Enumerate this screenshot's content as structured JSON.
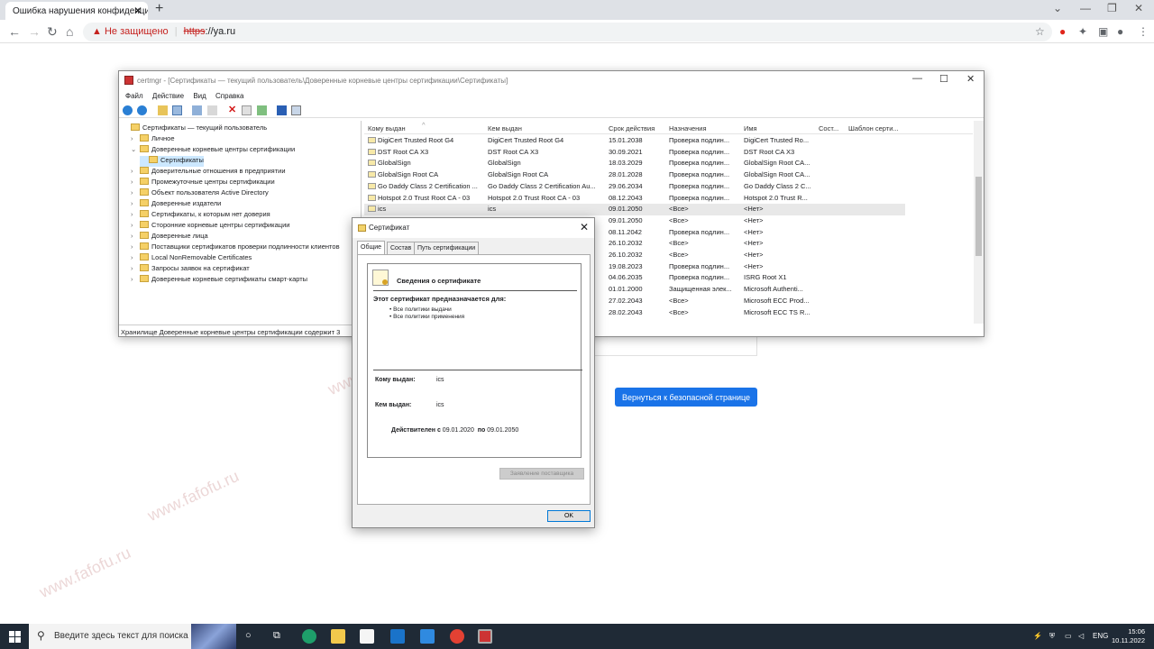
{
  "browser": {
    "tab_title": "Ошибка нарушения конфиденциальн",
    "tab_close": "✕",
    "new_tab": "+",
    "window_controls": [
      "⌄",
      "—",
      "❐",
      "✕"
    ],
    "nav": {
      "back": "←",
      "forward": "→",
      "reload": "↻",
      "home": "⌂"
    },
    "security_label": "Не защищено",
    "url_scheme": "https",
    "url_rest": "://ya.ru"
  },
  "page": {
    "back_button": "Вернуться к безопасной странице"
  },
  "certmgr": {
    "title": "certmgr - [Сертификаты — текущий пользователь\\Доверенные корневые центры сертификации\\Сертификаты]",
    "menu": [
      "Файл",
      "Действие",
      "Вид",
      "Справка"
    ],
    "tree": [
      {
        "label": "Сертификаты — текущий пользователь",
        "level": 0,
        "exp": ""
      },
      {
        "label": "Личное",
        "level": 1,
        "exp": "›"
      },
      {
        "label": "Доверенные корневые центры сертификации",
        "level": 1,
        "exp": "⌄"
      },
      {
        "label": "Сертификаты",
        "level": 2,
        "exp": ""
      },
      {
        "label": "Доверительные отношения в предприятии",
        "level": 1,
        "exp": "›"
      },
      {
        "label": "Промежуточные центры сертификации",
        "level": 1,
        "exp": "›"
      },
      {
        "label": "Объект пользователя Active Directory",
        "level": 1,
        "exp": "›"
      },
      {
        "label": "Доверенные издатели",
        "level": 1,
        "exp": "›"
      },
      {
        "label": "Сертификаты, к которым нет доверия",
        "level": 1,
        "exp": "›"
      },
      {
        "label": "Сторонние корневые центры сертификации",
        "level": 1,
        "exp": "›"
      },
      {
        "label": "Доверенные лица",
        "level": 1,
        "exp": "›"
      },
      {
        "label": "Поставщики сертификатов проверки подлинности клиентов",
        "level": 1,
        "exp": "›"
      },
      {
        "label": "Local NonRemovable Certificates",
        "level": 1,
        "exp": "›"
      },
      {
        "label": "Запросы заявок на сертификат",
        "level": 1,
        "exp": "›"
      },
      {
        "label": "Доверенные корневые сертификаты смарт-карты",
        "level": 1,
        "exp": "›"
      }
    ],
    "columns": [
      "Кому выдан",
      "Кем выдан",
      "Срок действия",
      "Назначения",
      "Имя",
      "Сост...",
      "Шаблон серти..."
    ],
    "rows": [
      [
        "DigiCert Trusted Root G4",
        "DigiCert Trusted Root G4",
        "15.01.2038",
        "Проверка подлин...",
        "DigiCert Trusted Ro..."
      ],
      [
        "DST Root CA X3",
        "DST Root CA X3",
        "30.09.2021",
        "Проверка подлин...",
        "DST Root CA X3"
      ],
      [
        "GlobalSign",
        "GlobalSign",
        "18.03.2029",
        "Проверка подлин...",
        "GlobalSign Root CA..."
      ],
      [
        "GlobalSign Root CA",
        "GlobalSign Root CA",
        "28.01.2028",
        "Проверка подлин...",
        "GlobalSign Root CA..."
      ],
      [
        "Go Daddy Class 2 Certification ...",
        "Go Daddy Class 2 Certification Au...",
        "29.06.2034",
        "Проверка подлин...",
        "Go Daddy Class 2 C..."
      ],
      [
        "Hotspot 2.0 Trust Root CA - 03",
        "Hotspot 2.0 Trust Root CA - 03",
        "08.12.2043",
        "Проверка подлин...",
        "Hotspot 2.0 Trust R..."
      ],
      [
        "ics",
        "ics",
        "09.01.2050",
        "<Все>",
        "<Нет>"
      ],
      [
        "",
        "",
        "09.01.2050",
        "<Все>",
        "<Нет>"
      ],
      [
        "",
        "",
        "08.11.2042",
        "Проверка подлин...",
        "<Нет>"
      ],
      [
        "",
        "",
        "26.10.2032",
        "<Все>",
        "<Нет>"
      ],
      [
        "",
        "",
        "26.10.2032",
        "<Все>",
        "<Нет>"
      ],
      [
        "",
        "",
        "19.08.2023",
        "Проверка подлин...",
        "<Нет>"
      ],
      [
        "",
        "",
        "04.06.2035",
        "Проверка подлин...",
        "ISRG Root X1"
      ],
      [
        "",
        "",
        "01.01.2000",
        "Защищенная элек...",
        "Microsoft Authenti..."
      ],
      [
        "",
        "",
        "27.02.2043",
        "<Все>",
        "Microsoft ECC Prod..."
      ],
      [
        "",
        "",
        "28.02.2043",
        "<Все>",
        "Microsoft ECC TS R..."
      ]
    ],
    "status": "Хранилище Доверенные корневые центры сертификации содержит 3"
  },
  "dialog": {
    "title": "Сертификат",
    "close": "✕",
    "tabs": [
      "Общие",
      "Состав",
      "Путь сертификации"
    ],
    "info_heading": "Сведения о сертификате",
    "purpose_heading": "Этот сертификат предназначается для:",
    "policies": [
      "• Все политики выдачи",
      "• Все политики применения"
    ],
    "issued_to_label": "Кому выдан:",
    "issued_to": "ics",
    "issued_by_label": "Кем выдан:",
    "issued_by": "ics",
    "valid_from_label": "Действителен с",
    "valid_from": "09.01.2020",
    "valid_to_label": "по",
    "valid_to": "09.01.2050",
    "issuer_statement": "Заявление поставщика",
    "ok": "OK"
  },
  "watermark": "www.fafofu.ru",
  "taskbar": {
    "search_placeholder": "Введите здесь текст для поиска",
    "lang": "ENG",
    "time": "15:06",
    "date": "10.11.2022"
  }
}
